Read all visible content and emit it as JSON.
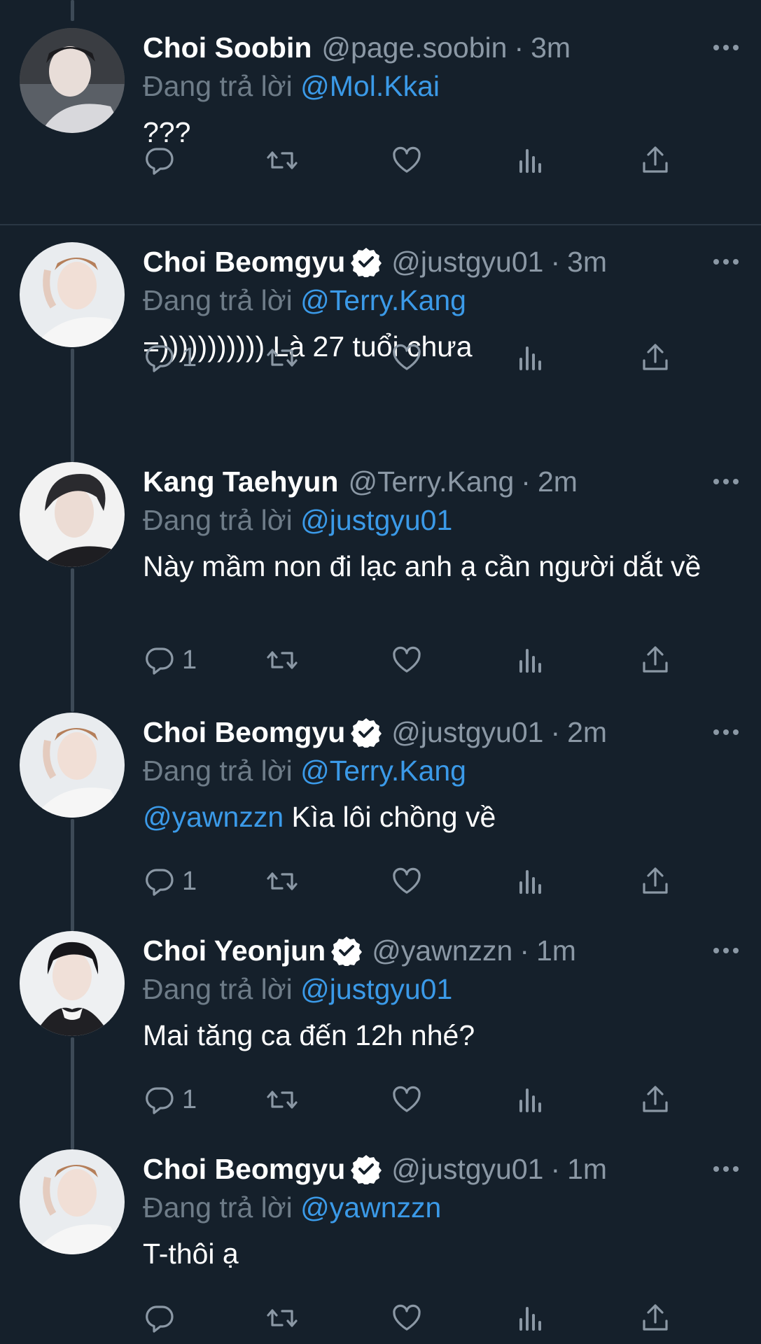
{
  "replying_prefix": "Đang trả lời",
  "tweets": [
    {
      "name": "Choi Soobin",
      "verified": false,
      "handle": "@page.soobin",
      "sep": "·",
      "time": "3m",
      "replying_to": "@Mol.Kkai",
      "mention": "",
      "text": "???",
      "reply_count": ""
    },
    {
      "name": "Choi Beomgyu",
      "verified": true,
      "handle": "@justgyu01",
      "sep": "·",
      "time": "3m",
      "replying_to": "@Terry.Kang",
      "mention": "",
      "text": "=))))))))))) Là 27 tuổi chưa",
      "reply_count": "1"
    },
    {
      "name": "Kang Taehyun",
      "verified": false,
      "handle": "@Terry.Kang",
      "sep": "·",
      "time": "2m",
      "replying_to": "@justgyu01",
      "mention": "",
      "text": "Này mầm non đi lạc anh ạ cần người dắt về",
      "reply_count": "1"
    },
    {
      "name": "Choi Beomgyu",
      "verified": true,
      "handle": "@justgyu01",
      "sep": "·",
      "time": "2m",
      "replying_to": "@Terry.Kang",
      "mention": "@yawnzzn",
      "text": " Kìa lôi chồng về",
      "reply_count": "1"
    },
    {
      "name": "Choi Yeonjun",
      "verified": true,
      "handle": "@yawnzzn",
      "sep": "·",
      "time": "1m",
      "replying_to": "@justgyu01",
      "mention": "",
      "text": "Mai tăng ca đến 12h nhé?",
      "reply_count": "1"
    },
    {
      "name": "Choi Beomgyu",
      "verified": true,
      "handle": "@justgyu01",
      "sep": "·",
      "time": "1m",
      "replying_to": "@yawnzzn",
      "mention": "",
      "text": "T-thôi ạ",
      "reply_count": ""
    }
  ],
  "colors": {
    "background": "#15202b",
    "text": "#ffffff",
    "muted": "#8b98a5",
    "link": "#3b9ae8",
    "verified": "#ffffff"
  },
  "icons": [
    "reply-icon",
    "retweet-icon",
    "like-icon",
    "views-icon",
    "share-icon",
    "more-icon",
    "verified-badge-icon"
  ]
}
